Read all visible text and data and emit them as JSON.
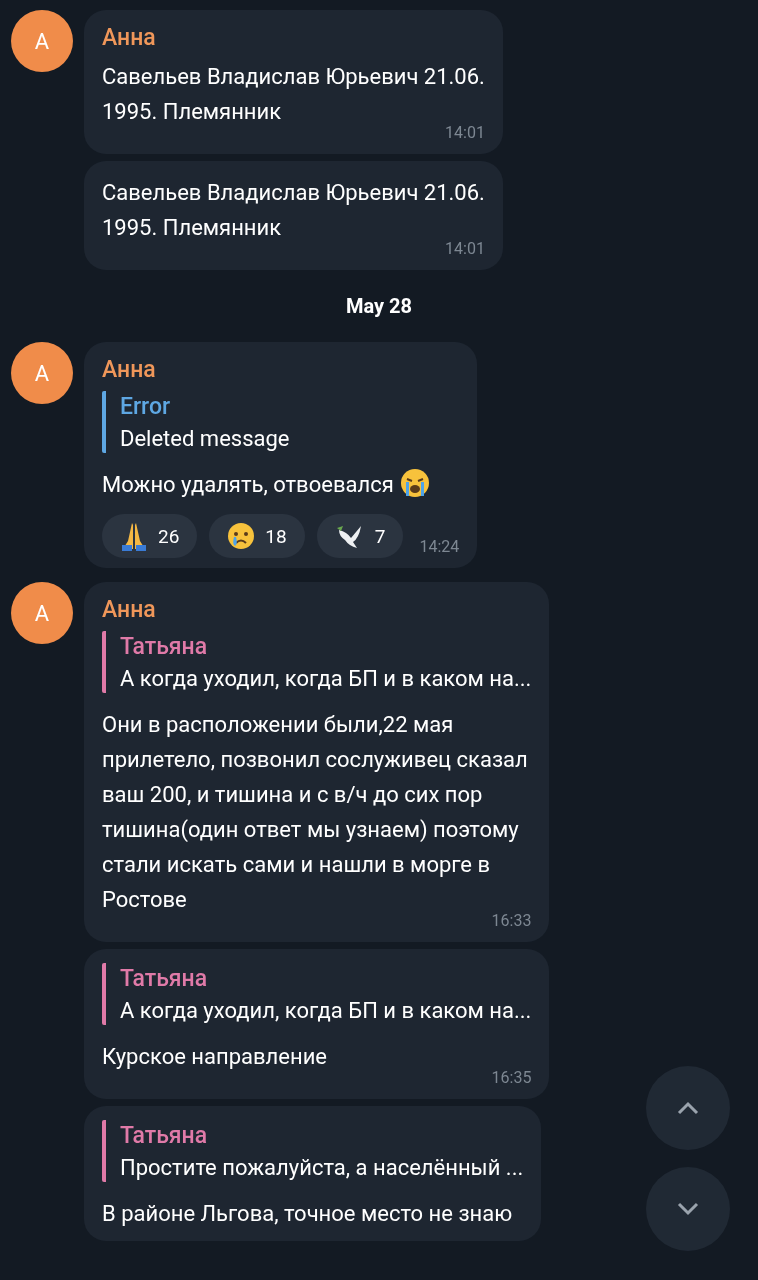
{
  "items": [
    {
      "kind": "group",
      "sender": "Анна",
      "avatar_letter": "А",
      "messages": [
        {
          "text": "Савельев Владислав Юрьевич 21.06.\n1995. Племянник",
          "time": "14:01"
        },
        {
          "text": "Савельев Владислав Юрьевич 21.06.\n1995. Племянник",
          "time": "14:01"
        }
      ]
    },
    {
      "kind": "date",
      "label": "May 28"
    },
    {
      "kind": "group",
      "sender": "Анна",
      "avatar_letter": "А",
      "messages": [
        {
          "reply": {
            "author": "Error",
            "text": "Deleted message",
            "color": "#5ea7e3"
          },
          "text": "Можно удалять, отвоевался",
          "emoji": {
            "kind": "sob"
          },
          "reactions": [
            {
              "kind": "pray",
              "count": "26"
            },
            {
              "kind": "cry",
              "count": "18"
            },
            {
              "kind": "dove",
              "count": "7"
            }
          ],
          "time": "14:24"
        }
      ]
    },
    {
      "kind": "group",
      "sender": "Анна",
      "avatar_letter": "А",
      "messages": [
        {
          "reply": {
            "author": "Татьяна",
            "text": "А когда уходил, когда БП и в каком на...",
            "color": "#e07aa8"
          },
          "text": "Они в расположении были,22 мая\nприлетело, позвонил сослуживец сказал\nваш 200, и тишина и с в/ч до сих пор\nтишина(один ответ мы узнаем) поэтому\nстали искать сами и нашли в морге в\nРостове",
          "time": "16:33"
        },
        {
          "reply": {
            "author": "Татьяна",
            "text": "А когда уходил, когда БП и в каком на...",
            "color": "#e07aa8"
          },
          "text": "Курское направление",
          "time": "16:35"
        },
        {
          "reply": {
            "author": "Татьяна",
            "text": "Простите пожалуйста, а населённый ...",
            "color": "#e07aa8"
          },
          "text": "В районе Льгова, точное место не знаю"
        }
      ]
    }
  ],
  "scroll_buttons": [
    {
      "kind": "up"
    },
    {
      "kind": "down"
    }
  ]
}
